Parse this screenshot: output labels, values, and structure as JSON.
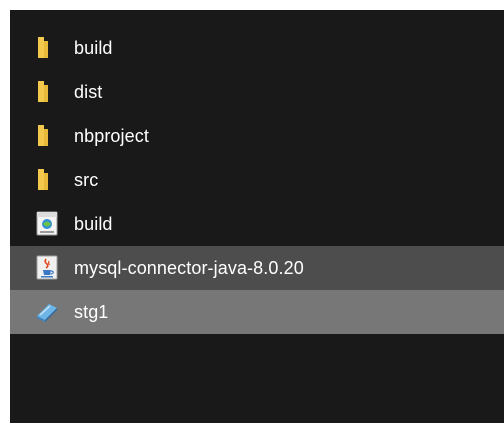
{
  "files": [
    {
      "name": "build",
      "icon": "folder-icon",
      "state": "normal"
    },
    {
      "name": "dist",
      "icon": "folder-icon",
      "state": "normal"
    },
    {
      "name": "nbproject",
      "icon": "folder-icon",
      "state": "normal"
    },
    {
      "name": "src",
      "icon": "folder-icon",
      "state": "normal"
    },
    {
      "name": "build",
      "icon": "xml-file-icon",
      "state": "normal"
    },
    {
      "name": "mysql-connector-java-8.0.20",
      "icon": "java-jar-icon",
      "state": "hover"
    },
    {
      "name": "stg1",
      "icon": "database-file-icon",
      "state": "selected"
    }
  ],
  "colors": {
    "background": "#191919",
    "folder": "#f2c94c",
    "hover_row": "#4d4d4d",
    "selected_row": "#777777",
    "text": "#ffffff"
  }
}
